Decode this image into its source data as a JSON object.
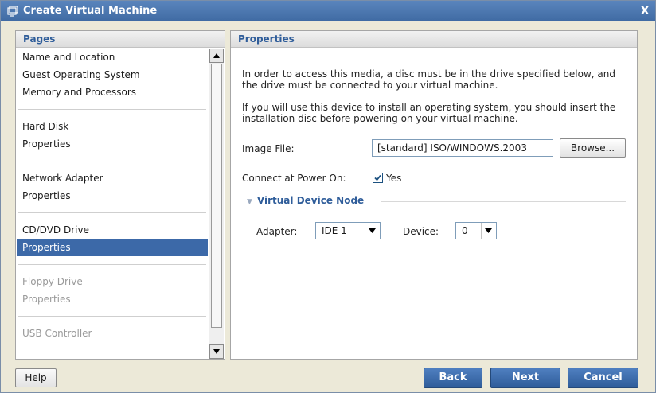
{
  "window": {
    "title": "Create Virtual Machine",
    "close_label": "X"
  },
  "left_pane": {
    "header": "Pages",
    "groups": [
      {
        "items": [
          {
            "label": "Name and Location",
            "state": "normal"
          },
          {
            "label": "Guest Operating System",
            "state": "normal"
          },
          {
            "label": "Memory and Processors",
            "state": "normal"
          }
        ]
      },
      {
        "items": [
          {
            "label": "Hard Disk",
            "state": "normal"
          },
          {
            "label": "Properties",
            "state": "normal"
          }
        ]
      },
      {
        "items": [
          {
            "label": "Network Adapter",
            "state": "normal"
          },
          {
            "label": "Properties",
            "state": "normal"
          }
        ]
      },
      {
        "items": [
          {
            "label": "CD/DVD Drive",
            "state": "normal"
          },
          {
            "label": "Properties",
            "state": "selected"
          }
        ]
      },
      {
        "items": [
          {
            "label": "Floppy Drive",
            "state": "disabled"
          },
          {
            "label": "Properties",
            "state": "disabled"
          }
        ]
      },
      {
        "items": [
          {
            "label": "USB Controller",
            "state": "disabled"
          }
        ]
      }
    ]
  },
  "right_pane": {
    "header": "Properties",
    "para1": "In order to access this media, a disc must be in the drive specified below, and the drive must be connected to your virtual machine.",
    "para2": "If you will use this device to install an operating system, you should insert the installation disc before powering on your virtual machine.",
    "image_file_label": "Image File:",
    "image_file_value": "[standard] ISO/WINDOWS.2003",
    "browse_label": "Browse...",
    "connect_label": "Connect at Power On:",
    "connect_checked": true,
    "connect_yes": "Yes",
    "section_title": "Virtual Device Node",
    "adapter_label": "Adapter:",
    "adapter_value": "IDE 1",
    "device_label": "Device:",
    "device_value": "0"
  },
  "footer": {
    "help": "Help",
    "back": "Back",
    "next": "Next",
    "cancel": "Cancel"
  },
  "colors": {
    "titlebar": "#3f6aa3",
    "accent": "#2f5d9a",
    "selected": "#3c69a8"
  }
}
